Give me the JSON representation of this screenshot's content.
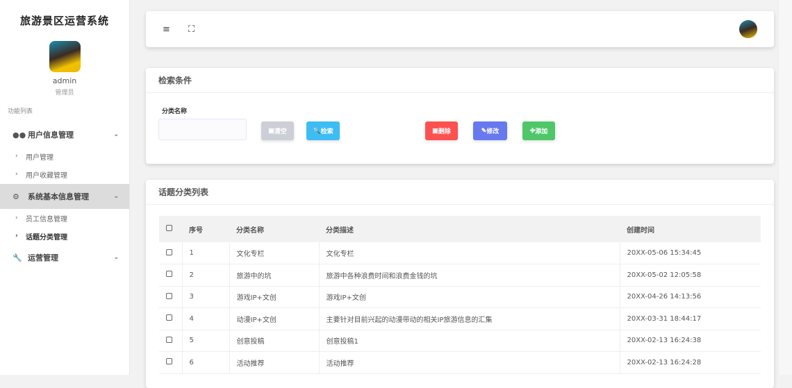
{
  "sidebar": {
    "title": "旅游景区运营系统",
    "username": "admin",
    "role": "管理员",
    "section": "功能列表",
    "menus": [
      {
        "label": "用户信息管理",
        "subs": [
          "用户管理",
          "用户收藏管理"
        ]
      },
      {
        "label": "系统基本信息管理",
        "subs": [
          "员工信息管理",
          "话题分类管理"
        ]
      },
      {
        "label": "运营管理"
      }
    ]
  },
  "search": {
    "title": "检索条件",
    "field_label": "分类名称",
    "field_value": "",
    "buttons": {
      "clear": "清空",
      "search": "检索",
      "delete": "删除",
      "edit": "修改",
      "add": "添加"
    }
  },
  "colors": {
    "clear": "#ccd0d6",
    "search": "#3dbdf4",
    "delete": "#fd5150",
    "edit": "#6779ef",
    "add": "#4fc768"
  },
  "list": {
    "title": "话题分类列表",
    "columns": [
      "序号",
      "分类名称",
      "分类描述",
      "创建时间"
    ],
    "rows": [
      [
        "1",
        "文化专栏",
        "文化专栏",
        "20XX-05-06 15:34:45"
      ],
      [
        "2",
        "旅游中的坑",
        "旅游中各种浪费时间和浪费金钱的坑",
        "20XX-05-02 12:05:58"
      ],
      [
        "3",
        "游戏IP+文创",
        "游戏IP+文创",
        "20XX-04-26 14:13:56"
      ],
      [
        "4",
        "动漫IP+文创",
        "主要针对目前兴起的动漫带动的相关IP旅游信息的汇集",
        "20XX-03-31 18:44:17"
      ],
      [
        "5",
        "创意投稿",
        "创意投稿1",
        "20XX-02-13 16:24:38"
      ],
      [
        "6",
        "活动推荐",
        "活动推荐",
        "20XX-02-13 16:24:28"
      ]
    ]
  }
}
